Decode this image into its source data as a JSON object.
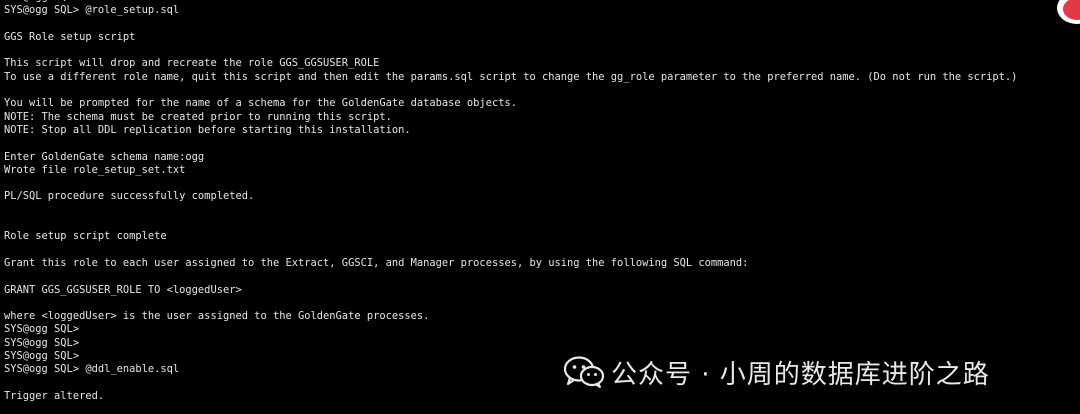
{
  "colors": {
    "background": "#000000",
    "text": "#e6e6e6",
    "watermark": "#e9e9e9",
    "avatar_accent": "#e23a45"
  },
  "terminal": {
    "lines": [
      "SYS@ogg SQL>",
      "SYS@ogg SQL> @role_setup.sql",
      "",
      "GGS Role setup script",
      "",
      "This script will drop and recreate the role GGS_GGSUSER_ROLE",
      "To use a different role name, quit this script and then edit the params.sql script to change the gg_role parameter to the preferred name. (Do not run the script.)",
      "",
      "You will be prompted for the name of a schema for the GoldenGate database objects.",
      "NOTE: The schema must be created prior to running this script.",
      "NOTE: Stop all DDL replication before starting this installation.",
      "",
      "Enter GoldenGate schema name:ogg",
      "Wrote file role_setup_set.txt",
      "",
      "PL/SQL procedure successfully completed.",
      "",
      "",
      "Role setup script complete",
      "",
      "Grant this role to each user assigned to the Extract, GGSCI, and Manager processes, by using the following SQL command:",
      "",
      "GRANT GGS_GGSUSER_ROLE TO <loggedUser>",
      "",
      "where <loggedUser> is the user assigned to the GoldenGate processes.",
      "SYS@ogg SQL>",
      "SYS@ogg SQL>",
      "SYS@ogg SQL>",
      "SYS@ogg SQL> @ddl_enable.sql",
      "",
      "Trigger altered."
    ]
  },
  "watermark": {
    "icon": "wechat-icon",
    "text": "公众号 · 小周的数据库进阶之路"
  },
  "avatar": {
    "icon": "avatar-icon"
  }
}
